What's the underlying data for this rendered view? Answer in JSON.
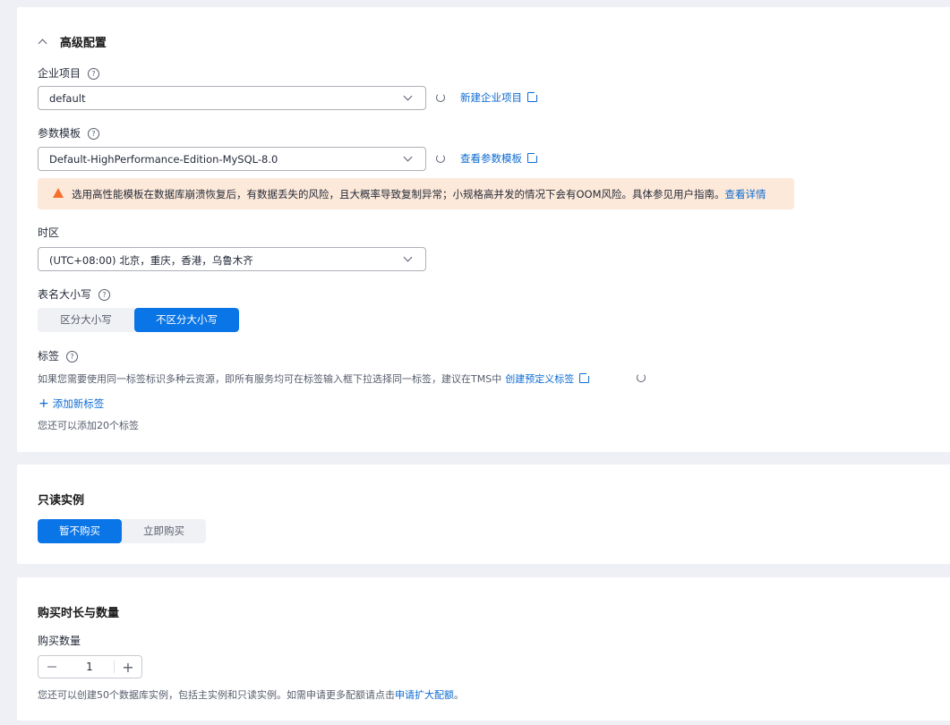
{
  "advanced": {
    "title": "高级配置",
    "enterprise_project": {
      "label": "企业项目",
      "value": "default",
      "link": "新建企业项目"
    },
    "param_template": {
      "label": "参数模板",
      "value": "Default-HighPerformance-Edition-MySQL-8.0",
      "link": "查看参数模板"
    },
    "warning": {
      "text": "选用高性能模板在数据库崩溃恢复后，有数据丢失的风险，且大概率导致复制异常；小规格高并发的情况下会有OOM风险。具体参见用户指南。",
      "link": "查看详情"
    },
    "timezone": {
      "label": "时区",
      "value": "(UTC+08:00) 北京，重庆，香港，乌鲁木齐"
    },
    "case_sensitivity": {
      "label": "表名大小写",
      "options": [
        "区分大小写",
        "不区分大小写"
      ],
      "selected": "不区分大小写"
    },
    "tags": {
      "label": "标签",
      "desc": "如果您需要使用同一标签标识多种云资源，即所有服务均可在标签输入框下拉选择同一标签，建议在TMS中",
      "link": "创建预定义标签",
      "add": "添加新标签",
      "remaining": "您还可以添加20个标签"
    }
  },
  "readonly": {
    "title": "只读实例",
    "options": [
      "暂不购买",
      "立即购买"
    ],
    "selected": "暂不购买"
  },
  "purchase": {
    "title": "购买时长与数量",
    "quantity_label": "购买数量",
    "quantity": "1",
    "note": "您还可以创建50个数据库实例，包括主实例和只读实例。如需申请更多配额请点击",
    "note_link": "申请扩大配额",
    "note_end": "。"
  }
}
